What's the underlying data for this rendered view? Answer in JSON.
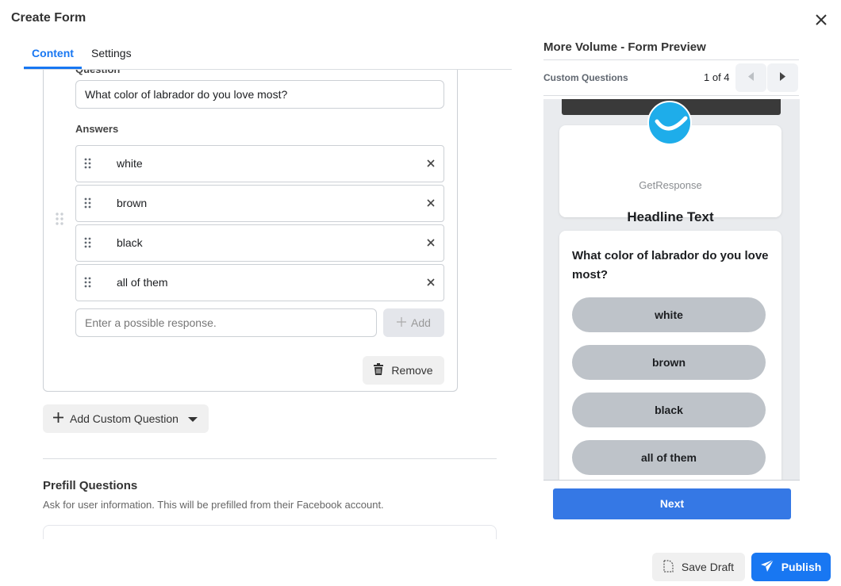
{
  "dialog": {
    "title": "Create Form",
    "close_icon": "close-icon"
  },
  "tabs": [
    {
      "label": "Content",
      "active": true
    },
    {
      "label": "Settings",
      "active": false
    }
  ],
  "question_editor": {
    "question_label": "Question",
    "question_value": "What color of labrador do you love most?",
    "answers_label": "Answers",
    "answers": [
      "white",
      "brown",
      "black",
      "all of them"
    ],
    "response_placeholder": "Enter a possible response.",
    "add_label": "Add",
    "remove_label": "Remove"
  },
  "add_custom_question_label": "Add Custom Question",
  "prefill": {
    "title": "Prefill Questions",
    "description": "Ask for user information. This will be prefilled from their Facebook account."
  },
  "preview": {
    "title": "More Volume - Form Preview",
    "section": "Custom Questions",
    "page_indicator": "1 of 4",
    "brand_name": "GetResponse",
    "headline": "Headline Text",
    "question": "What color of labrador do you love most?",
    "options": [
      "white",
      "brown",
      "black",
      "all of them"
    ],
    "next_label": "Next"
  },
  "footer": {
    "save_draft_label": "Save Draft",
    "publish_label": "Publish"
  },
  "colors": {
    "accent": "#1877f2",
    "next_button": "#3578e5",
    "logo": "#1eadea"
  }
}
